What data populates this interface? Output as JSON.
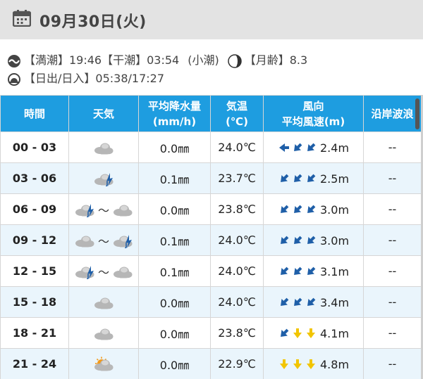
{
  "header": {
    "date": "09月30日(火)",
    "calendar_icon": "calendar-icon"
  },
  "tide": {
    "high_label": "【満潮】19:46",
    "low_label": "【干潮】03:54",
    "tide_type": "(小潮)",
    "moon_label": "【月齢】8.3",
    "sun_label": "【日出/日入】05:38/17:27",
    "icons": {
      "tide": "wave-icon",
      "moon": "moon-icon",
      "sun": "sunrise-icon"
    }
  },
  "table": {
    "headers": {
      "time": "時間",
      "weather": "天気",
      "precip_l1": "平均降水量",
      "precip_l2": "(mm/h)",
      "temp_l1": "気温",
      "temp_l2": "(℃)",
      "wind_l1": "風向",
      "wind_l2": "平均風速(m)",
      "wave": "沿岸波浪"
    },
    "rows": [
      {
        "time": "00 - 03",
        "weather": [
          "cloud"
        ],
        "precip": "0.0㎜",
        "temp": "24.0℃",
        "wind_dirs": [
          "W",
          "SW",
          "SW"
        ],
        "wind_speed": "2.4m",
        "wave": "--"
      },
      {
        "time": "03 - 06",
        "weather": [
          "cloud-rain"
        ],
        "precip": "0.1㎜",
        "temp": "23.7℃",
        "wind_dirs": [
          "SW",
          "SW",
          "SW"
        ],
        "wind_speed": "2.5m",
        "wave": "--"
      },
      {
        "time": "06 - 09",
        "weather": [
          "cloud-rain",
          "cloud"
        ],
        "precip": "0.0㎜",
        "temp": "23.8℃",
        "wind_dirs": [
          "SW",
          "SW",
          "SW"
        ],
        "wind_speed": "3.0m",
        "wave": "--"
      },
      {
        "time": "09 - 12",
        "weather": [
          "cloud",
          "cloud-rain"
        ],
        "precip": "0.1㎜",
        "temp": "24.0℃",
        "wind_dirs": [
          "SW",
          "SW",
          "SW"
        ],
        "wind_speed": "3.0m",
        "wave": "--"
      },
      {
        "time": "12 - 15",
        "weather": [
          "cloud-rain",
          "cloud"
        ],
        "precip": "0.1㎜",
        "temp": "24.0℃",
        "wind_dirs": [
          "SW",
          "SW",
          "SW"
        ],
        "wind_speed": "3.1m",
        "wave": "--"
      },
      {
        "time": "15 - 18",
        "weather": [
          "cloud"
        ],
        "precip": "0.0㎜",
        "temp": "24.0℃",
        "wind_dirs": [
          "SW",
          "SW",
          "SW"
        ],
        "wind_speed": "3.4m",
        "wave": "--"
      },
      {
        "time": "18 - 21",
        "weather": [
          "cloud"
        ],
        "precip": "0.0㎜",
        "temp": "23.8℃",
        "wind_dirs": [
          "SW",
          "S",
          "S"
        ],
        "wind_speed": "4.1m",
        "wave": "--"
      },
      {
        "time": "21 - 24",
        "weather": [
          "sun-cloud"
        ],
        "precip": "0.0㎜",
        "temp": "22.9℃",
        "wind_dirs": [
          "S",
          "S",
          "S"
        ],
        "wind_speed": "4.8m",
        "wave": "--"
      }
    ],
    "tilde": "～"
  },
  "colors": {
    "header_bg": "#1e9de0",
    "alt_row": "#eaf5fc",
    "wind_blue": "#1f5fa8",
    "wind_yellow": "#f2c500",
    "date_bar": "#e3e3e3"
  }
}
